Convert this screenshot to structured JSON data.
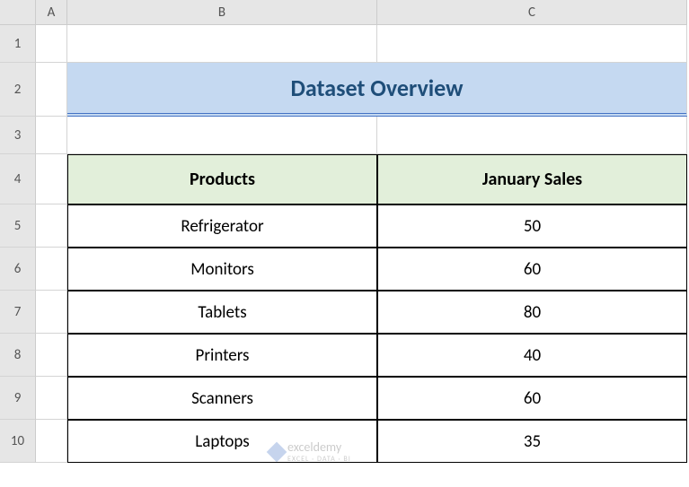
{
  "columns": [
    "A",
    "B",
    "C"
  ],
  "rows": [
    "1",
    "2",
    "3",
    "4",
    "5",
    "6",
    "7",
    "8",
    "9",
    "10"
  ],
  "title": "Dataset Overview",
  "headers": {
    "products": "Products",
    "january_sales": "January Sales"
  },
  "chart_data": {
    "type": "table",
    "title": "Dataset Overview",
    "columns": [
      "Products",
      "January Sales"
    ],
    "rows": [
      {
        "product": "Refrigerator",
        "sales": "50"
      },
      {
        "product": "Monitors",
        "sales": "60"
      },
      {
        "product": "Tablets",
        "sales": "80"
      },
      {
        "product": "Printers",
        "sales": "40"
      },
      {
        "product": "Scanners",
        "sales": "60"
      },
      {
        "product": "Laptops",
        "sales": "35"
      }
    ]
  },
  "watermark": {
    "name": "exceldemy",
    "tagline": "EXCEL · DATA · BI"
  }
}
